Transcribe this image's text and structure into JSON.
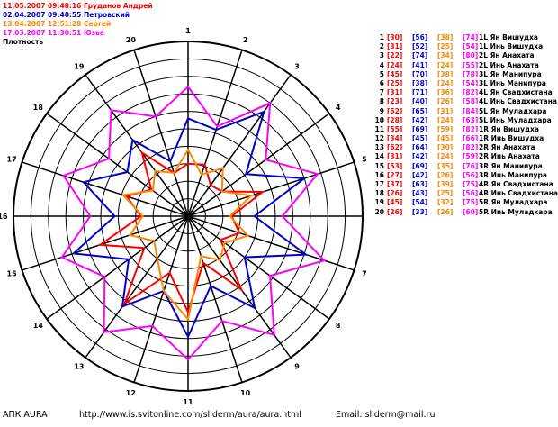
{
  "sessions": [
    {
      "label": "11.05.2007 09:48:16 Груданов Андрей",
      "color": "#ff0000"
    },
    {
      "label": "02.04.2007 09:40:55 Петровский",
      "color": "#0000cc"
    },
    {
      "label": "13.04.2007 12:51:28 Сергей",
      "color": "#ff8800"
    },
    {
      "label": "17.03.2007 11:30:51 Юзва",
      "color": "#ff00ff"
    }
  ],
  "title": "Плотность",
  "chart_data": {
    "type": "radar",
    "title": "Плотность",
    "axes": [
      "1",
      "2",
      "3",
      "4",
      "5",
      "6",
      "7",
      "8",
      "9",
      "10",
      "11",
      "12",
      "13",
      "14",
      "15",
      "16",
      "17",
      "18",
      "19",
      "20"
    ],
    "rmax": 100,
    "rings": [
      10,
      20,
      30,
      40,
      50,
      60,
      70,
      80,
      90,
      100
    ],
    "series": [
      {
        "name": "11.05.2007 09:48:16 Груданов Андрей",
        "color": "#ff0000",
        "values": [
          30,
          31,
          22,
          24,
          45,
          25,
          31,
          23,
          52,
          28,
          55,
          34,
          62,
          31,
          53,
          27,
          37,
          26,
          45,
          26
        ]
      },
      {
        "name": "02.04.2007 09:40:55 Петровский",
        "color": "#0000cc",
        "values": [
          56,
          52,
          74,
          41,
          70,
          38,
          71,
          40,
          65,
          42,
          69,
          45,
          64,
          42,
          69,
          42,
          63,
          43,
          54,
          33
        ]
      },
      {
        "name": "13.04.2007 12:51:28 Сергей",
        "color": "#ff8800",
        "values": [
          38,
          25,
          34,
          24,
          38,
          24,
          36,
          26,
          31,
          24,
          59,
          45,
          30,
          24,
          35,
          26,
          39,
          25,
          32,
          26
        ]
      },
      {
        "name": "17.03.2007 11:30:51 Юзва",
        "color": "#ff00ff",
        "values": [
          74,
          54,
          80,
          55,
          78,
          54,
          82,
          58,
          84,
          63,
          82,
          66,
          82,
          59,
          76,
          56,
          75,
          56,
          75,
          60
        ]
      }
    ]
  },
  "channels": [
    {
      "idx": "1",
      "v": [
        "[30]",
        "[56]",
        "[38]",
        "[74]"
      ],
      "label": "1L Ян Вишудха"
    },
    {
      "idx": "2",
      "v": [
        "[31]",
        "[52]",
        "[25]",
        "[54]"
      ],
      "label": "1L Инь Вишудха"
    },
    {
      "idx": "3",
      "v": [
        "[22]",
        "[74]",
        "[34]",
        "[80]"
      ],
      "label": "2L Ян Анахата"
    },
    {
      "idx": "4",
      "v": [
        "[24]",
        "[41]",
        "[24]",
        "[55]"
      ],
      "label": "2L Инь Анахата"
    },
    {
      "idx": "5",
      "v": [
        "[45]",
        "[70]",
        "[38]",
        "[78]"
      ],
      "label": "3L Ян Манипура"
    },
    {
      "idx": "6",
      "v": [
        "[25]",
        "[38]",
        "[24]",
        "[54]"
      ],
      "label": "3L Инь Манипура"
    },
    {
      "idx": "7",
      "v": [
        "[31]",
        "[71]",
        "[36]",
        "[82]"
      ],
      "label": "4L Ян Свадхистана"
    },
    {
      "idx": "8",
      "v": [
        "[23]",
        "[40]",
        "[26]",
        "[58]"
      ],
      "label": "4L Инь Свадхистана"
    },
    {
      "idx": "9",
      "v": [
        "[52]",
        "[65]",
        "[31]",
        "[84]"
      ],
      "label": "5L Ян Муладхара"
    },
    {
      "idx": "10",
      "v": [
        "[28]",
        "[42]",
        "[24]",
        "[63]"
      ],
      "label": "5L Инь Муладхара"
    },
    {
      "idx": "11",
      "v": [
        "[55]",
        "[69]",
        "[59]",
        "[82]"
      ],
      "label": "1R Ян Вишудха"
    },
    {
      "idx": "12",
      "v": [
        "[34]",
        "[45]",
        "[45]",
        "[66]"
      ],
      "label": "1R Инь Вишудха"
    },
    {
      "idx": "13",
      "v": [
        "[62]",
        "[64]",
        "[30]",
        "[82]"
      ],
      "label": "2R Ян Анахата"
    },
    {
      "idx": "14",
      "v": [
        "[31]",
        "[42]",
        "[24]",
        "[59]"
      ],
      "label": "2R Инь Анахата"
    },
    {
      "idx": "15",
      "v": [
        "[53]",
        "[69]",
        "[35]",
        "[76]"
      ],
      "label": "3R Ян Манипура"
    },
    {
      "idx": "16",
      "v": [
        "[27]",
        "[42]",
        "[26]",
        "[56]"
      ],
      "label": "3R Инь Манипура"
    },
    {
      "idx": "17",
      "v": [
        "[37]",
        "[63]",
        "[39]",
        "[75]"
      ],
      "label": "4R Ян Свадхистана"
    },
    {
      "idx": "18",
      "v": [
        "[26]",
        "[43]",
        "[25]",
        "[56]"
      ],
      "label": "4R Инь Свадхистана"
    },
    {
      "idx": "19",
      "v": [
        "[45]",
        "[54]",
        "[32]",
        "[75]"
      ],
      "label": "5R Ян Муладхара"
    },
    {
      "idx": "20",
      "v": [
        "[26]",
        "[33]",
        "[26]",
        "[60]"
      ],
      "label": "5R Инь Муладхара"
    }
  ],
  "footer": {
    "app": "АПК AURA",
    "url": "http://www.is.svitonline.com/sliderm/aura/aura.html",
    "email": "Email: sliderm@mail.ru"
  }
}
